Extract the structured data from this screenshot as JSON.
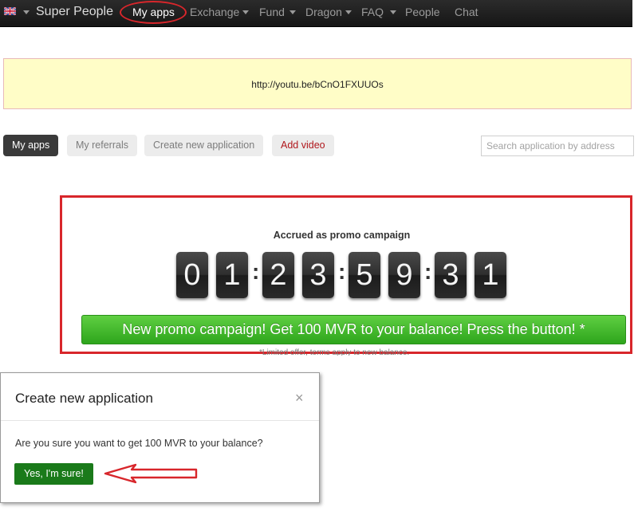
{
  "navbar": {
    "flag_icon": "uk-flag-icon",
    "brand": "Super People",
    "items": [
      {
        "label": "My apps",
        "active": true,
        "dropdown": false
      },
      {
        "label": "Exchange",
        "dropdown": true
      },
      {
        "label": "Fund",
        "dropdown": true
      },
      {
        "label": "Dragon",
        "dropdown": true
      },
      {
        "label": "FAQ",
        "dropdown": true
      },
      {
        "label": "People",
        "dropdown": false
      },
      {
        "label": "Chat",
        "dropdown": false
      }
    ]
  },
  "banner": {
    "text": "http://youtu.be/bCnO1FXUUOs"
  },
  "tabs": [
    {
      "label": "My apps",
      "active": true
    },
    {
      "label": "My referrals"
    },
    {
      "label": "Create new application"
    },
    {
      "label": "Add video"
    }
  ],
  "search": {
    "placeholder": "Search application by address"
  },
  "promo": {
    "heading": "Accrued as promo campaign",
    "counter_digits": [
      "0",
      "1",
      "2",
      "3",
      "5",
      "9",
      "3",
      "1"
    ],
    "separator": ":",
    "button_label": "New promo campaign! Get 100 MVR to your balance! Press the button! *",
    "footnote": "*Limited offer, terms apply to new balance."
  },
  "modal": {
    "title": "Create new application",
    "close_symbol": "×",
    "message": "Are you sure you want to get 100 MVR to your balance?",
    "confirm_label": "Yes, I'm sure!"
  },
  "colors": {
    "navbar_bg": "#1e1e1e",
    "annotation_red": "#d8262b",
    "banner_bg": "#fffdc7",
    "promo_green": "#3fb52a",
    "confirm_green": "#1a7a1a",
    "active_tab": "#3a3a3a"
  }
}
